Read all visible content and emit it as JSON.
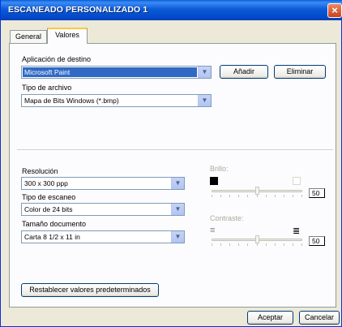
{
  "window": {
    "title": "ESCANEADO PERSONALIZADO 1",
    "close_symbol": "×"
  },
  "tabs": [
    {
      "label": "General"
    },
    {
      "label": "Valores"
    }
  ],
  "destination": {
    "label": "Aplicación de destino",
    "value": "Microsoft Paint",
    "add_label": "Añadir",
    "delete_label": "Eliminar"
  },
  "file_type": {
    "label": "Tipo de archivo",
    "value": "Mapa de Bits Windows (*.bmp)"
  },
  "resolution": {
    "label": "Resolución",
    "value": "300 x 300 ppp"
  },
  "scan_type": {
    "label": "Tipo de escaneo",
    "value": "Color de 24 bits"
  },
  "doc_size": {
    "label": "Tamaño documento",
    "value": "Carta 8 1/2 x 11 in"
  },
  "brightness": {
    "label": "Brillo:",
    "value": "50",
    "level_percent": 50
  },
  "contrast": {
    "label": "Contraste:",
    "value": "50",
    "level_percent": 50
  },
  "restore_label": "Restablecer valores predeterminados",
  "ok_label": "Aceptar",
  "cancel_label": "Cancelar"
}
